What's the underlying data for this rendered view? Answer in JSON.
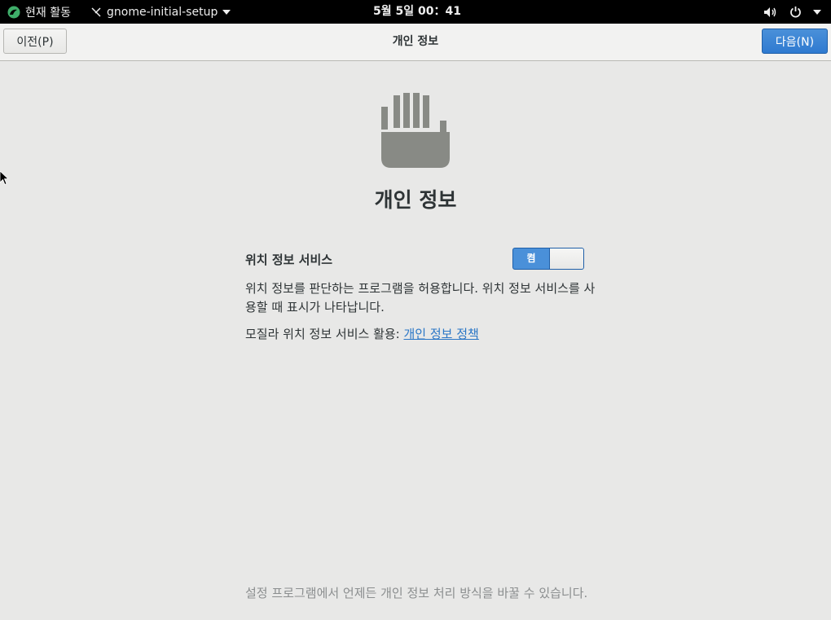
{
  "topbar": {
    "activities": "현재 활동",
    "app_name": "gnome-initial-setup",
    "clock": "5월 5일  00：41"
  },
  "header": {
    "back_label": "이전(P)",
    "title": "개인 정보",
    "next_label": "다음(N)"
  },
  "content": {
    "heading": "개인 정보",
    "location_label": "위치 정보 서비스",
    "toggle_state": "켬",
    "description": "위치 정보를 판단하는 프로그램을 허용합니다. 위치 정보 서비스를 사용할 때 표시가 나타납니다.",
    "policy_prefix": "모질라 위치 정보 서비스 활용: ",
    "policy_link": "개인 정보 정책",
    "footer": "설정 프로그램에서 언제든 개인 정보 처리 방식을 바꿀 수 있습니다."
  },
  "colors": {
    "accent": "#3584e4",
    "link": "#2a76c6",
    "icon_gray": "#888a85"
  }
}
